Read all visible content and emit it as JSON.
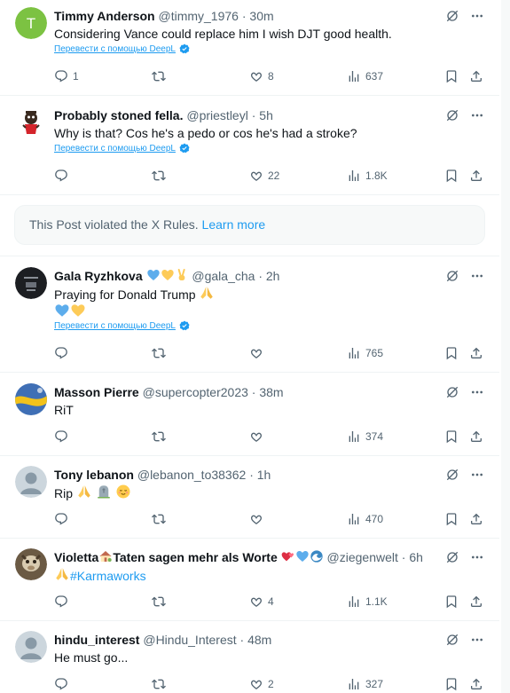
{
  "translate_label": "Перевести с помощью DeepL",
  "violation": {
    "text": "This Post violated the X Rules.",
    "link": "Learn more"
  },
  "tweets": [
    {
      "name": "Timmy Anderson",
      "handle": "@timmy_1976",
      "time": "30m",
      "text": "Considering Vance could replace him I wish DJT good health.",
      "replies": "1",
      "likes": "8",
      "views": "637",
      "avatar_color": "#7cc242",
      "avatar_letter": "T"
    },
    {
      "name": "Probably stoned fella.",
      "handle": "@priestleyl",
      "time": "5h",
      "text": "Why is that? Cos he's a pedo or cos he's had a stroke?",
      "likes": "22",
      "views": "1.8K"
    },
    {
      "name": "Gala Ryzhkova",
      "handle": "@gala_cha",
      "time": "2h",
      "text": "Praying for Donald Trump",
      "views": "765"
    },
    {
      "name": "Masson Pierre",
      "handle": "@supercopter2023",
      "time": "38m",
      "text": "RiT",
      "views": "374"
    },
    {
      "name": "Tony lebanon",
      "handle": "@lebanon_to38362",
      "time": "1h",
      "text": "Rip",
      "views": "470"
    },
    {
      "name": "Violetta",
      "name_rest": "Taten sagen mehr als Worte",
      "handle": "@ziegenwelt",
      "time": "6h",
      "text": "#Karmaworks",
      "likes": "4",
      "views": "1.1K"
    },
    {
      "name": "hindu_interest",
      "handle": "@Hindu_Interest",
      "time": "48m",
      "text": "He must go...",
      "likes": "2",
      "views": "327"
    }
  ],
  "separator": "·",
  "colors": {
    "accent": "#1d9bf0",
    "muted": "#536471",
    "text": "#0f1419",
    "border": "#eff3f4"
  }
}
